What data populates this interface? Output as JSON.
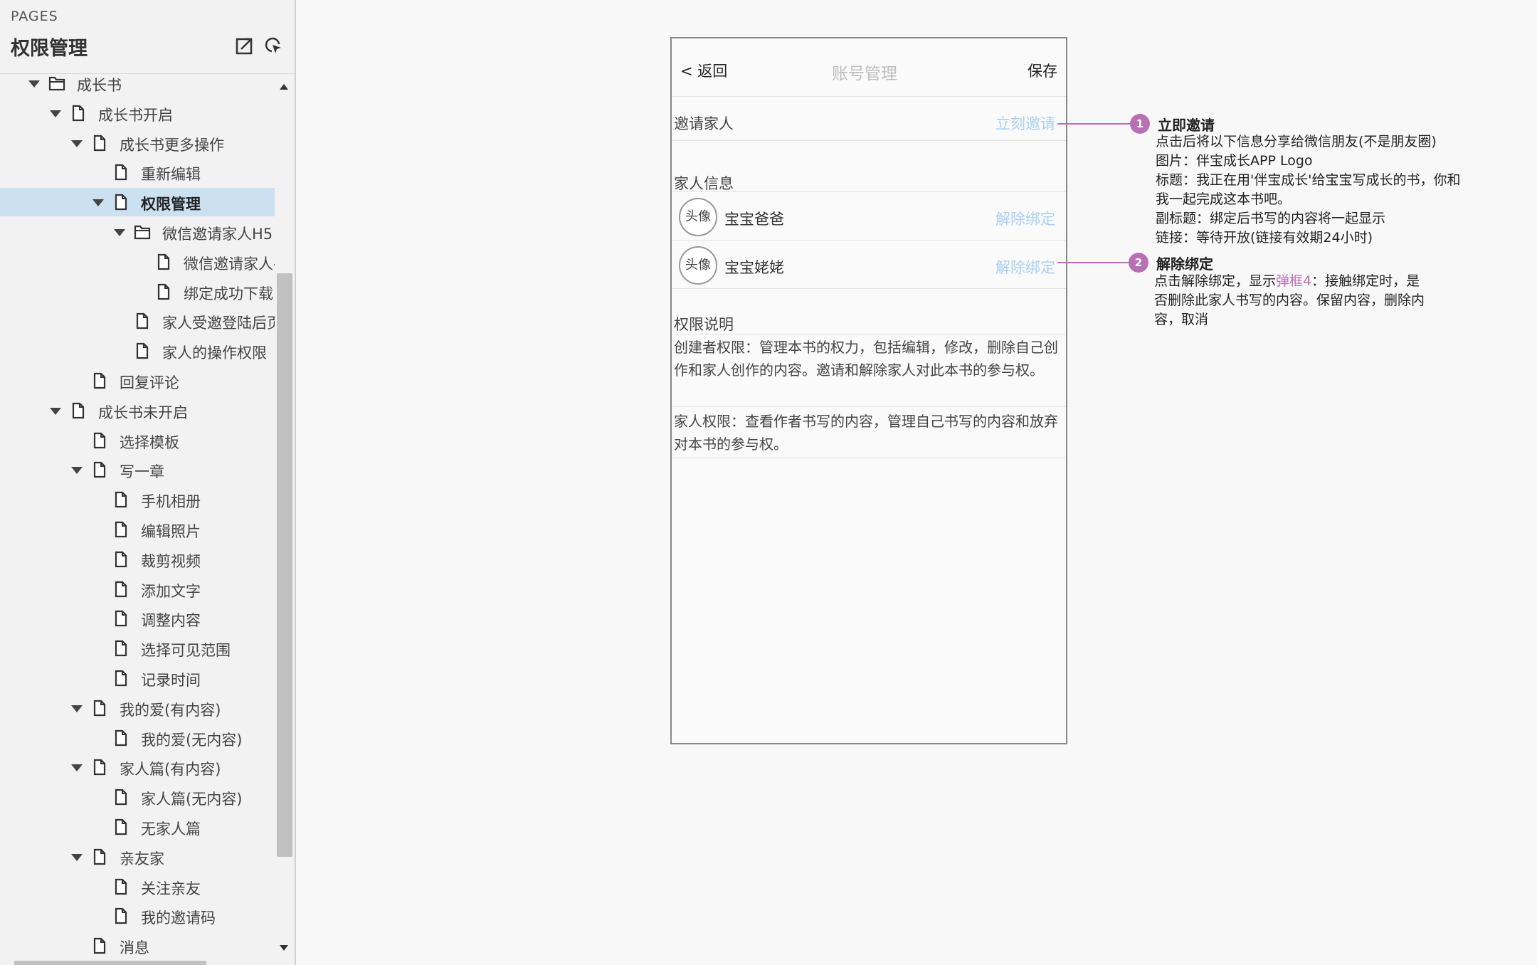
{
  "sidebar": {
    "pages_label": "PAGES",
    "title": "权限管理",
    "tree": [
      {
        "label": "成长书",
        "level": 1,
        "type": "folder",
        "expanded": true
      },
      {
        "label": "成长书开启",
        "level": 2,
        "type": "page",
        "expanded": true
      },
      {
        "label": "成长书更多操作",
        "level": 3,
        "type": "page",
        "expanded": true
      },
      {
        "label": "重新编辑",
        "level": 4,
        "type": "page"
      },
      {
        "label": "权限管理",
        "level": 4,
        "type": "page",
        "expanded": true,
        "selected": true
      },
      {
        "label": "微信邀请家人H5",
        "level": 5,
        "type": "folder",
        "expanded": true
      },
      {
        "label": "微信邀请家人-",
        "level": 6,
        "type": "page"
      },
      {
        "label": "绑定成功下载",
        "level": 6,
        "type": "page"
      },
      {
        "label": "家人受邀登陆后页",
        "level": 5,
        "type": "page"
      },
      {
        "label": "家人的操作权限",
        "level": 5,
        "type": "page"
      },
      {
        "label": "回复评论",
        "level": 3,
        "type": "page"
      },
      {
        "label": "成长书未开启",
        "level": 2,
        "type": "page",
        "expanded": true
      },
      {
        "label": "选择模板",
        "level": 3,
        "type": "page"
      },
      {
        "label": "写一章",
        "level": 3,
        "type": "page",
        "expanded": true
      },
      {
        "label": "手机相册",
        "level": 4,
        "type": "page"
      },
      {
        "label": "编辑照片",
        "level": 4,
        "type": "page"
      },
      {
        "label": "裁剪视频",
        "level": 4,
        "type": "page"
      },
      {
        "label": "添加文字",
        "level": 4,
        "type": "page"
      },
      {
        "label": "调整内容",
        "level": 4,
        "type": "page"
      },
      {
        "label": "选择可见范围",
        "level": 4,
        "type": "page"
      },
      {
        "label": "记录时间",
        "level": 4,
        "type": "page"
      },
      {
        "label": "我的爱(有内容)",
        "level": 3,
        "type": "page",
        "expanded": true
      },
      {
        "label": "我的爱(无内容)",
        "level": 4,
        "type": "page"
      },
      {
        "label": "家人篇(有内容)",
        "level": 3,
        "type": "page",
        "expanded": true
      },
      {
        "label": "家人篇(无内容)",
        "level": 4,
        "type": "page"
      },
      {
        "label": "无家人篇",
        "level": 4,
        "type": "page"
      },
      {
        "label": "亲友家",
        "level": 3,
        "type": "page",
        "expanded": true
      },
      {
        "label": "关注亲友",
        "level": 4,
        "type": "page"
      },
      {
        "label": "我的邀请码",
        "level": 4,
        "type": "page"
      },
      {
        "label": "消息",
        "level": 3,
        "type": "page"
      }
    ]
  },
  "phone": {
    "back": "< 返回",
    "title": "账号管理",
    "save": "保存",
    "invite_label": "邀请家人",
    "invite_link": "立刻邀请",
    "family_header": "家人信息",
    "members": [
      {
        "avatar": "头像",
        "name": "宝宝爸爸",
        "action": "解除绑定"
      },
      {
        "avatar": "头像",
        "name": "宝宝姥姥",
        "action": "解除绑定"
      }
    ],
    "perm_header": "权限说明",
    "creator_perm": "创建者权限：管理本书的权力，包括编辑，修改，删除自己创作和家人创作的内容。邀请和解除家人对此本书的参与权。",
    "family_perm": "家人权限：查看作者书写的内容，管理自己书写的内容和放弃对本书的参与权。"
  },
  "annotations": [
    {
      "number": "1",
      "title": "立即邀请",
      "lines": [
        "点击后将以下信息分享给微信朋友(不是朋友圈)",
        "图片：伴宝成长APP Logo",
        "标题：我正在用'伴宝成长'给宝宝写成长的书，你和",
        "我一起完成这本书吧。",
        "副标题：绑定后书写的内容将一起显示",
        "链接：等待开放(链接有效期24小时)"
      ]
    },
    {
      "number": "2",
      "title": "解除绑定",
      "line1_pre": "点击解除绑定，显示",
      "line1_link": "弹框4",
      "line1_post": "：接触绑定时，是",
      "line2": "否删除此家人书写的内容。保留内容，删除内",
      "line3": "容，取消"
    }
  ],
  "colors": {
    "selected_row": "#cbe1f2",
    "marker": "#b86fb4",
    "link_light": "#a9d0f2"
  }
}
